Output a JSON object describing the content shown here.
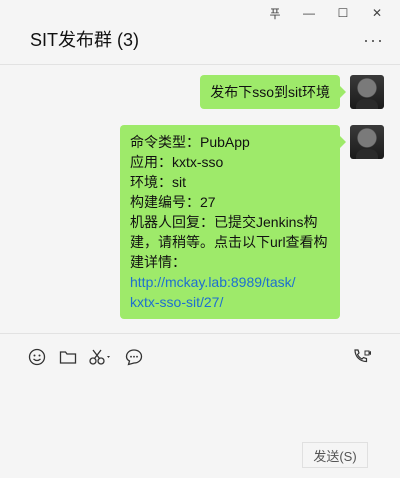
{
  "window": {
    "controls": {
      "pin": "푸",
      "minimize": "—",
      "maximize": "☐",
      "close": "✕"
    }
  },
  "chat": {
    "title": "SIT发布群 (3)",
    "more": "···"
  },
  "messages": [
    {
      "lines": [
        "发布下sso到sit环境"
      ]
    },
    {
      "lines": [
        "命令类型：PubApp",
        "应用：kxtx-sso",
        "环境：sit",
        "构建编号：27",
        "机器人回复：已提交Jenkins构",
        "建，请稍等。点击以下url查看构",
        "建详情："
      ],
      "link_lines": [
        "http://mckay.lab:8989/task/",
        "kxtx-sso-sit/27/"
      ]
    }
  ],
  "toolbar": {
    "icons": [
      "emoji-icon",
      "folder-icon",
      "scissors-icon",
      "chat-bubble-icon",
      "video-call-icon"
    ]
  },
  "send_button": "发送(S)",
  "colors": {
    "bubble": "#9eea6a",
    "link": "#1e6fd0",
    "background": "#f5f5f5"
  }
}
